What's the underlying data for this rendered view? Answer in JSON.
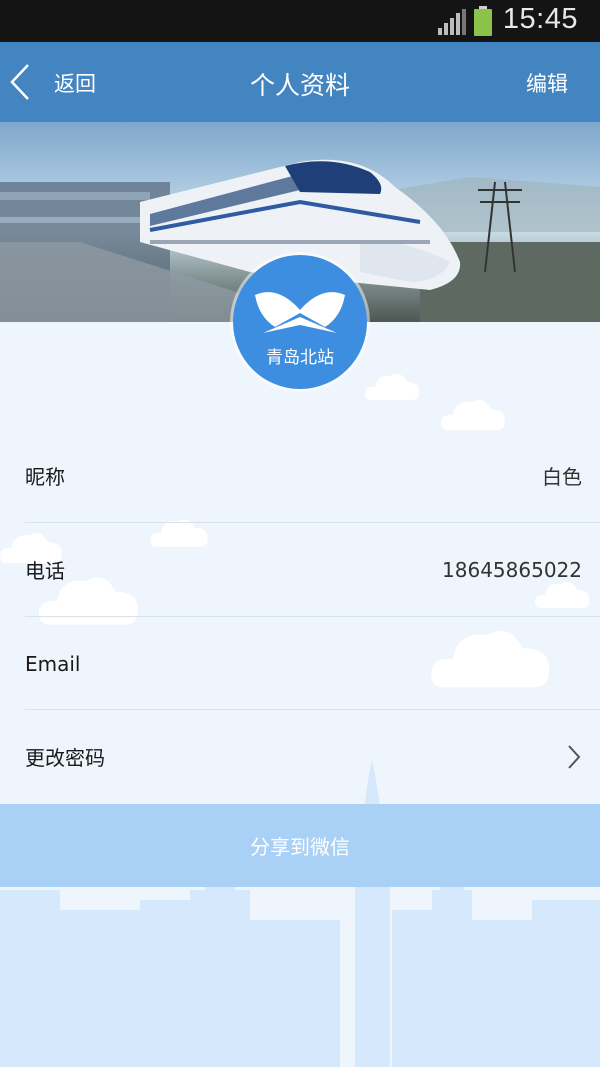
{
  "status_bar": {
    "time": "15:45"
  },
  "header": {
    "back_label": "返回",
    "title": "个人资料",
    "edit_label": "编辑"
  },
  "profile": {
    "avatar_text": "青岛北站"
  },
  "fields": [
    {
      "label": "昵称",
      "value": "白色"
    },
    {
      "label": "电话",
      "value": "18645865022"
    },
    {
      "label": "Email",
      "value": ""
    },
    {
      "label": "更改密码",
      "value": ""
    }
  ],
  "share_button": {
    "label": "分享到微信"
  },
  "colors": {
    "header_bg": "#4385c0",
    "avatar_bg": "#3d8ee0",
    "share_bg": "#a9d0f5",
    "page_bg": "#eef5fd"
  }
}
